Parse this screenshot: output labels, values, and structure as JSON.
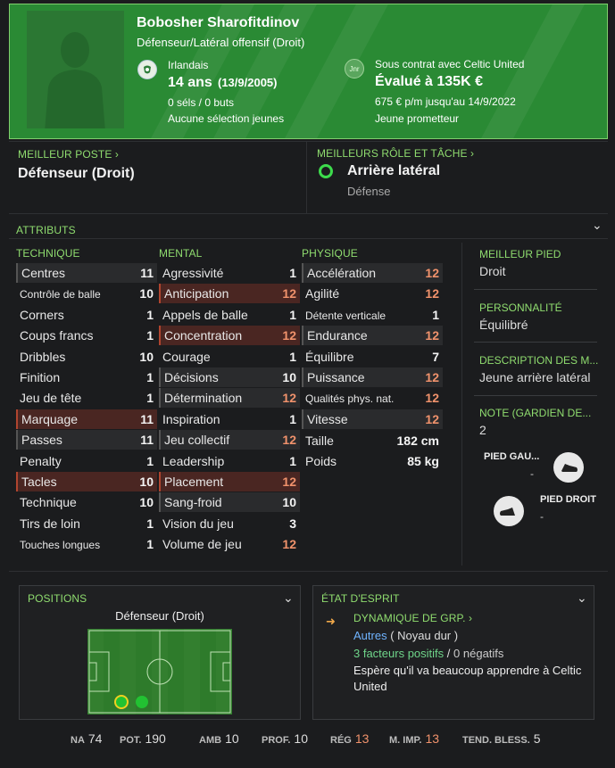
{
  "player": {
    "name": "Bobosher Sharofitdinov",
    "role": "Défenseur/Latéral offensif (Droit)",
    "nationality": "Irlandais",
    "age": "14 ans",
    "dob": "(13/9/2005)",
    "caps": "0 séls / 0 buts",
    "youth": "Aucune sélection jeunes",
    "contract": "Sous contrat avec Celtic United",
    "value": "Évalué à 135K €",
    "wage": "675 € p/m jusqu'au 14/9/2022",
    "status": "Jeune prometteur",
    "jnr_badge": "Jnr"
  },
  "best_position": {
    "label": "MEILLEUR POSTE",
    "value": "Défenseur (Droit)"
  },
  "best_role": {
    "label": "MEILLEURS RÔLE ET TÂCHE",
    "value": "Arrière latéral",
    "duty": "Défense"
  },
  "attributes": {
    "title": "ATTRIBUTS",
    "technique": {
      "header": "TECHNIQUE",
      "rows": [
        {
          "name": "Centres",
          "value": "11"
        },
        {
          "name": "Contrôle de balle",
          "value": "10"
        },
        {
          "name": "Corners",
          "value": "1"
        },
        {
          "name": "Coups francs",
          "value": "1"
        },
        {
          "name": "Dribbles",
          "value": "10"
        },
        {
          "name": "Finition",
          "value": "1"
        },
        {
          "name": "Jeu de tête",
          "value": "1"
        },
        {
          "name": "Marquage",
          "value": "11"
        },
        {
          "name": "Passes",
          "value": "11"
        },
        {
          "name": "Penalty",
          "value": "1"
        },
        {
          "name": "Tacles",
          "value": "10"
        },
        {
          "name": "Technique",
          "value": "10"
        },
        {
          "name": "Tirs de loin",
          "value": "1"
        },
        {
          "name": "Touches longues",
          "value": "1"
        }
      ]
    },
    "mental": {
      "header": "MENTAL",
      "rows": [
        {
          "name": "Agressivité",
          "value": "1"
        },
        {
          "name": "Anticipation",
          "value": "12"
        },
        {
          "name": "Appels de balle",
          "value": "1"
        },
        {
          "name": "Concentration",
          "value": "12"
        },
        {
          "name": "Courage",
          "value": "1"
        },
        {
          "name": "Décisions",
          "value": "10"
        },
        {
          "name": "Détermination",
          "value": "12"
        },
        {
          "name": "Inspiration",
          "value": "1"
        },
        {
          "name": "Jeu collectif",
          "value": "12"
        },
        {
          "name": "Leadership",
          "value": "1"
        },
        {
          "name": "Placement",
          "value": "12"
        },
        {
          "name": "Sang-froid",
          "value": "10"
        },
        {
          "name": "Vision du jeu",
          "value": "3"
        },
        {
          "name": "Volume de jeu",
          "value": "12"
        }
      ]
    },
    "physique": {
      "header": "PHYSIQUE",
      "rows": [
        {
          "name": "Accélération",
          "value": "12"
        },
        {
          "name": "Agilité",
          "value": "12"
        },
        {
          "name": "Détente verticale",
          "value": "1"
        },
        {
          "name": "Endurance",
          "value": "12"
        },
        {
          "name": "Équilibre",
          "value": "7"
        },
        {
          "name": "Puissance",
          "value": "12"
        },
        {
          "name": "Qualités phys. nat.",
          "value": "12"
        },
        {
          "name": "Vitesse",
          "value": "12"
        }
      ],
      "height_label": "Taille",
      "height": "182 cm",
      "weight_label": "Poids",
      "weight": "85 kg"
    }
  },
  "side": {
    "best_foot_label": "MEILLEUR PIED",
    "best_foot": "Droit",
    "personality_label": "PERSONNALITÉ",
    "personality": "Équilibré",
    "media_label": "DESCRIPTION DES M...",
    "media": "Jeune arrière latéral",
    "gk_label": "NOTE (GARDIEN DE...",
    "gk": "2",
    "left_foot_label": "PIED GAU...",
    "left_foot": "-",
    "right_foot_label": "PIED DROIT",
    "right_foot": "-"
  },
  "positions": {
    "title": "POSITIONS",
    "label": "Défenseur (Droit)"
  },
  "state": {
    "title": "ÉTAT D'ESPRIT",
    "dyn_label": "DYNAMIQUE DE GRP.",
    "group": "Autres",
    "group_note": "( Noyau dur )",
    "positives": "3 facteurs positifs",
    "sep": "/",
    "negatives": "0 négatifs",
    "message": "Espère qu'il va beaucoup apprendre à Celtic United"
  },
  "footer": [
    {
      "key": "NA",
      "value": "74",
      "orange": false
    },
    {
      "key": "POT.",
      "value": "190",
      "orange": false
    },
    {
      "key": "AMB",
      "value": "10",
      "orange": false
    },
    {
      "key": "PROF.",
      "value": "10",
      "orange": false
    },
    {
      "key": "RÉG",
      "value": "13",
      "orange": true
    },
    {
      "key": "M. IMP.",
      "value": "13",
      "orange": true
    },
    {
      "key": "TEND. BLESS.",
      "value": "5",
      "orange": false
    }
  ],
  "colors": {
    "header_green": "#2a8a34",
    "label_green": "#8fdc6f",
    "highlight_orange": "#f0926c"
  }
}
